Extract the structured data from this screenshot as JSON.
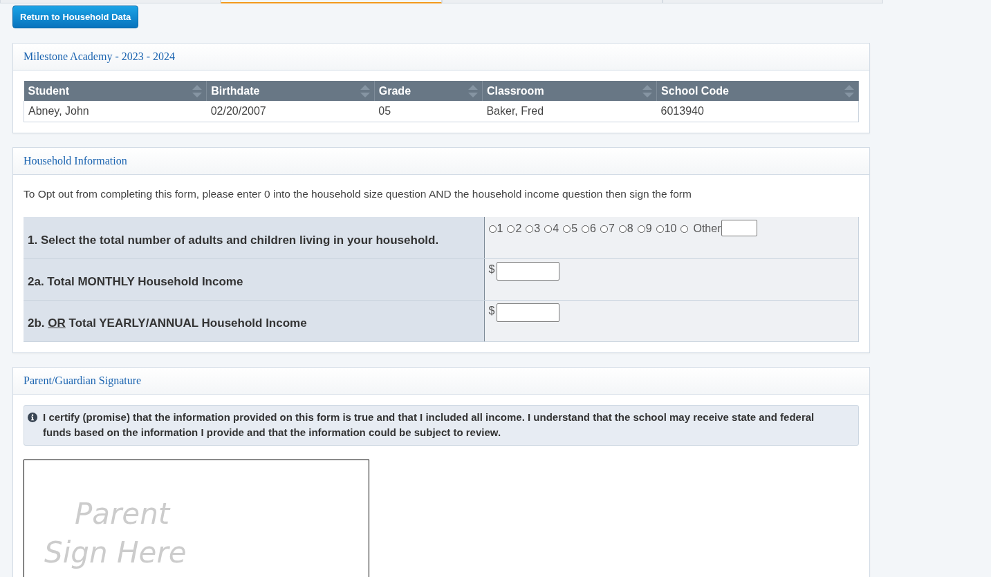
{
  "tab_strip": [
    {
      "selected": false
    },
    {
      "selected": true
    },
    {
      "selected": false
    },
    {
      "selected": false
    }
  ],
  "return_button": "Return to Household Data",
  "school_panel": {
    "title": "Milestone Academy - 2023 - 2024",
    "table": {
      "columns": [
        "Student",
        "Birthdate",
        "Grade",
        "Classroom",
        "School Code"
      ],
      "rows": [
        [
          "Abney, John",
          "02/20/2007",
          "05",
          "Baker, Fred",
          "6013940"
        ]
      ]
    }
  },
  "household_panel": {
    "title": "Household Information",
    "instructions": "To Opt out from completing this form, please enter 0 into the household size question AND the household income question then sign the form",
    "questions": [
      {
        "kind": "radio",
        "label": [
          {
            "text": "1. Select the total number of adults and children living in your household.",
            "underline": false
          }
        ],
        "options": [
          {
            "label": "1",
            "selected": false
          },
          {
            "label": "2",
            "selected": false
          },
          {
            "label": "3",
            "selected": false
          },
          {
            "label": "4",
            "selected": false
          },
          {
            "label": "5",
            "selected": false
          },
          {
            "label": "6",
            "selected": false
          },
          {
            "label": "7",
            "selected": false
          },
          {
            "label": "8",
            "selected": false
          },
          {
            "label": "9",
            "selected": false
          },
          {
            "label": "10",
            "selected": false
          },
          {
            "label": "Other",
            "selected": false,
            "kind": "with_field"
          }
        ]
      },
      {
        "kind": "money",
        "label": [
          {
            "text": "2a. Total MONTHLY Household Income",
            "underline": false
          }
        ],
        "currency": "$"
      },
      {
        "kind": "money",
        "label": [
          {
            "text": "2b. ",
            "underline": false
          },
          {
            "text": "OR",
            "underline": true
          },
          {
            "text": " Total YEARLY/ANNUAL Household Income",
            "underline": false
          }
        ],
        "currency": "$"
      }
    ]
  },
  "signature_panel": {
    "title": "Parent/Guardian Signature",
    "notice": "I certify (promise) that the information provided on this form is true and that I included all income. I understand that the school may receive state and federal funds based on the information I provide and that the information could be subject to review.",
    "pad_placeholder": [
      "Parent",
      "Sign Here"
    ]
  }
}
